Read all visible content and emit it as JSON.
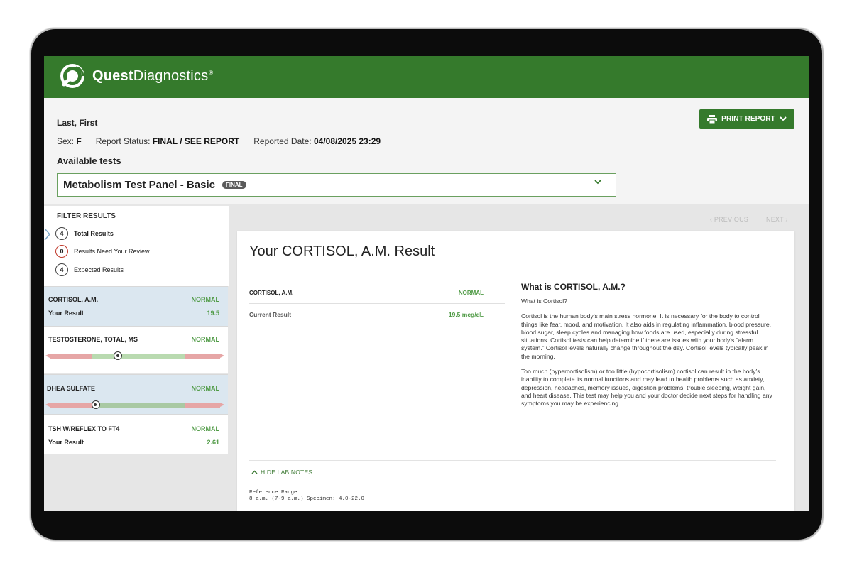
{
  "brand": {
    "name_bold": "Quest",
    "name_light": "Diagnostics",
    "reg": "®",
    "header_color": "#357a2c"
  },
  "patient": {
    "name": "Last, First",
    "sex_label": "Sex:",
    "sex_value": "F",
    "status_label": "Report Status:",
    "status_value": "FINAL / SEE REPORT",
    "date_label": "Reported Date:",
    "date_value": "04/08/2025 23:29"
  },
  "actions": {
    "print_label": "PRINT REPORT"
  },
  "available_tests": {
    "heading": "Available tests",
    "selected": "Metabolism Test Panel - Basic",
    "badge": "FINAL"
  },
  "filter": {
    "title": "FILTER RESULTS",
    "items": [
      {
        "count": "4",
        "label": "Total Results"
      },
      {
        "count": "0",
        "label": "Results Need Your Review"
      },
      {
        "count": "4",
        "label": "Expected Results"
      }
    ]
  },
  "results_list": [
    {
      "name": "CORTISOL, A.M.",
      "status": "NORMAL",
      "sub_label": "Your Result",
      "value": "19.5"
    },
    {
      "name": "TESTOSTERONE, TOTAL, MS",
      "status": "NORMAL",
      "range_position": 0.4
    },
    {
      "name": "DHEA SULFATE",
      "status": "NORMAL",
      "range_position": 0.27
    },
    {
      "name": "TSH W/REFLEX TO FT4",
      "status": "NORMAL",
      "sub_label": "Your Result",
      "value": "2.61"
    }
  ],
  "nav": {
    "previous": "‹ PREVIOUS",
    "next": "NEXT ›"
  },
  "detail": {
    "title": "Your CORTISOL, A.M. Result",
    "test_name": "CORTISOL, A.M.",
    "status": "NORMAL",
    "current_label": "Current Result",
    "current_value": "19.5 mcg/dL",
    "info_heading": "What is CORTISOL, A.M.?",
    "info_sub": "What is Cortisol?",
    "info_p1": "Cortisol is the human body’s main stress hormone. It is necessary for the body to control things like fear, mood, and motivation. It also aids in regulating inflammation, blood pressure, blood sugar, sleep cycles and managing how foods are used, especially during stressful situations. Cortisol tests can help determine if there are issues with your body’s “alarm system.” Cortisol levels naturally change throughout the day. Cortisol levels typically peak in the morning.",
    "info_p2": "Too much (hypercortisolism) or too little (hypocortisolism) cortisol can result in the body’s inability to complete its normal functions and may lead to health problems such as anxiety, depression, headaches, memory issues, digestion problems, trouble sleeping, weight gain, and heart disease. This test may help you and your doctor decide next steps for handling any symptoms you may be experiencing.",
    "hide_notes": "HIDE LAB NOTES",
    "lab_notes": "Reference Range\n8 a.m. (7-9 a.m.) Specimen: 4.0-22.0"
  },
  "colors": {
    "normal": "#4f9a45",
    "low_high": "#e6a6a6",
    "normal_range": "#b9dab0",
    "selected_bg": "#dbe7f0"
  }
}
